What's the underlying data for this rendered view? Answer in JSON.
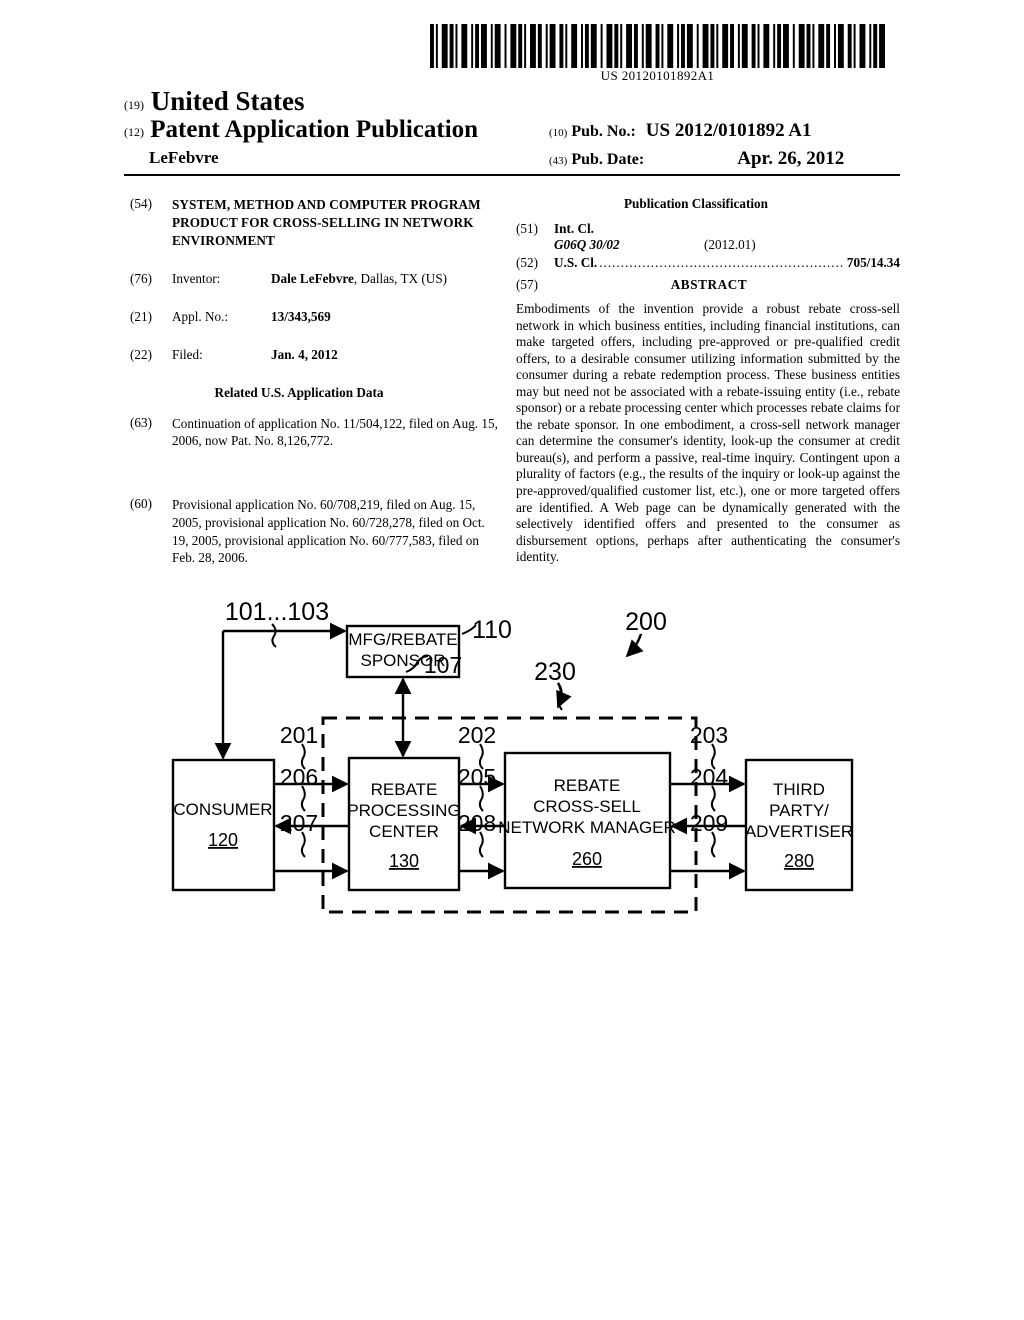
{
  "barcode": {
    "publication_number_text": "US 20120101892A1",
    "pattern": "1101001110110100111001011011100101110010011101101001110110010111001101001110010110111001001110110100111011001011100110100111001011011100100111011010011101100101110011010011100101101110010011101101001110110010111001101001110010110111"
  },
  "masthead": {
    "tag_19": "(19)",
    "country": "United States",
    "tag_12": "(12)",
    "doc_type": "Patent Application Publication",
    "inventor_surname": "LeFebvre",
    "tag_10": "(10)",
    "pubno_label": "Pub. No.:",
    "pubno_value": "US 2012/0101892 A1",
    "tag_43": "(43)",
    "pubdate_label": "Pub. Date:",
    "pubdate_value": "Apr. 26, 2012"
  },
  "left_column": {
    "title": {
      "tag": "(54)",
      "text": "SYSTEM, METHOD AND COMPUTER PROGRAM PRODUCT FOR CROSS-SELLING IN NETWORK ENVIRONMENT"
    },
    "inventor": {
      "tag": "(76)",
      "label": "Inventor:",
      "name": "Dale LeFebvre",
      "location": ", Dallas, TX (US)"
    },
    "appl_no": {
      "tag": "(21)",
      "label": "Appl. No.:",
      "value": "13/343,569"
    },
    "filed": {
      "tag": "(22)",
      "label": "Filed:",
      "value": "Jan. 4, 2012"
    },
    "related_heading": "Related U.S. Application Data",
    "related_63": {
      "tag": "(63)",
      "text": "Continuation of application No. 11/504,122, filed on Aug. 15, 2006, now Pat. No. 8,126,772."
    },
    "related_60": {
      "tag": "(60)",
      "text": "Provisional application No. 60/708,219, filed on Aug. 15, 2005, provisional application No. 60/728,278, filed on Oct. 19, 2005, provisional application No. 60/777,583, filed on Feb. 28, 2006."
    }
  },
  "right_column": {
    "pubclass_heading": "Publication Classification",
    "int_cl": {
      "tag": "(51)",
      "label": "Int. Cl.",
      "code": "G06Q 30/02",
      "version": "(2012.01)"
    },
    "us_cl": {
      "tag": "(52)",
      "label": "U.S. Cl.",
      "dots": "..................................................................",
      "value": "705/14.34"
    },
    "abstract": {
      "tag": "(57)",
      "title": "ABSTRACT",
      "text": "Embodiments of the invention provide a robust rebate cross-sell network in which business entities, including financial institutions, can make targeted offers, including pre-approved or pre-qualified credit offers, to a desirable consumer utilizing information submitted by the consumer during a rebate redemption process. These business entities may but need not be associated with a rebate-issuing entity (i.e., rebate sponsor) or a rebate processing center which processes rebate claims for the rebate sponsor. In one embodiment, a cross-sell network manager can determine the consumer's identity, look-up the consumer at credit bureau(s), and perform a passive, real-time inquiry. Contingent upon a plurality of factors (e.g., the results of the inquiry or look-up against the pre-approved/qualified customer list, etc.), one or more targeted offers are identified. A Web page can be dynamically generated with the selectively identified offers and presented to the consumer as disbursement options, perhaps after authenticating the consumer's identity."
    }
  },
  "figure": {
    "boxes": {
      "mfg_sponsor": {
        "line1": "MFG/REBATE",
        "line2": "SPONSOR"
      },
      "consumer": {
        "line1": "CONSUMER",
        "ref": "120"
      },
      "rebate_processing_center": {
        "line1": "REBATE",
        "line2": "PROCESSING",
        "line3": "CENTER",
        "ref": "130"
      },
      "cross_sell_manager": {
        "line1": "REBATE",
        "line2": "CROSS-SELL",
        "line3": "NETWORK MANAGER",
        "ref": "260"
      },
      "third_party": {
        "line1": "THIRD",
        "line2": "PARTY/",
        "line3": "ADVERTISER",
        "ref": "280"
      }
    },
    "callouts": {
      "sources": "101...103",
      "mfg_sponsor": "110",
      "sponsor_link": "107",
      "system": "200",
      "boundary": "230",
      "consumer_to_rpc": "201",
      "rpc_to_manager": "202",
      "manager_to_third": "203",
      "third_to_manager": "204",
      "manager_to_rpc": "205",
      "rpc_to_consumer": "206",
      "consumer_to_rpc_2": "207",
      "rpc_to_manager_2": "208",
      "manager_to_third_2": "209"
    }
  }
}
